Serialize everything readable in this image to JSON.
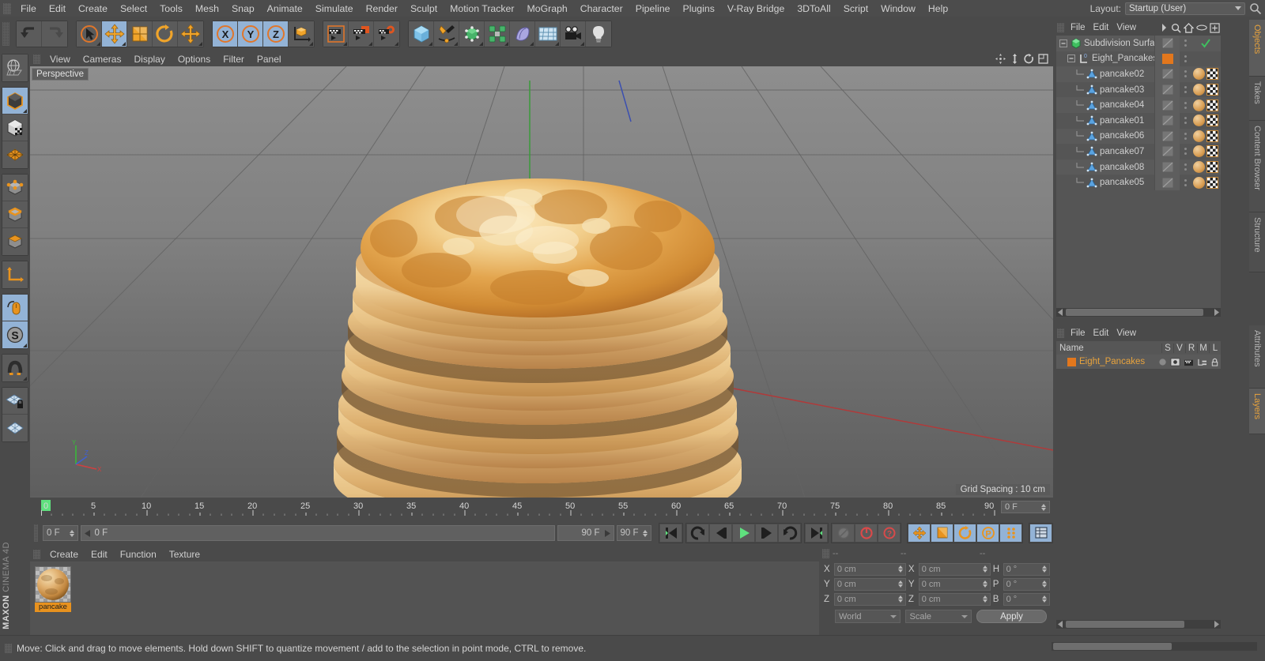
{
  "menubar": {
    "items": [
      "File",
      "Edit",
      "Create",
      "Select",
      "Tools",
      "Mesh",
      "Snap",
      "Animate",
      "Simulate",
      "Render",
      "Sculpt",
      "Motion Tracker",
      "MoGraph",
      "Character",
      "Pipeline",
      "Plugins",
      "V-Ray Bridge",
      "3DToAll",
      "Script",
      "Window",
      "Help"
    ],
    "layout_label": "Layout:",
    "layout_value": "Startup (User)"
  },
  "toolbar": {
    "groups": [
      {
        "name": "history",
        "buttons": [
          {
            "icon": "undo-icon",
            "state": "normal"
          },
          {
            "icon": "redo-icon",
            "state": "disabled"
          }
        ]
      },
      {
        "name": "transform",
        "buttons": [
          {
            "icon": "select-live-icon",
            "state": "normal"
          },
          {
            "icon": "move-tool-icon",
            "state": "active"
          },
          {
            "icon": "scale-tool-icon",
            "state": "normal"
          },
          {
            "icon": "rotate-tool-icon",
            "state": "normal"
          },
          {
            "icon": "move-axis-icon",
            "state": "normal"
          }
        ]
      },
      {
        "name": "axis-locks",
        "buttons": [
          {
            "icon": "axis-x-icon",
            "state": "active"
          },
          {
            "icon": "axis-y-icon",
            "state": "active"
          },
          {
            "icon": "axis-z-icon",
            "state": "active"
          },
          {
            "icon": "world-coordinates-icon",
            "state": "normal"
          }
        ]
      },
      {
        "name": "render",
        "buttons": [
          {
            "icon": "render-view-icon",
            "state": "normal"
          },
          {
            "icon": "render-to-picture-viewer-icon",
            "state": "normal"
          },
          {
            "icon": "render-settings-icon",
            "state": "normal"
          }
        ]
      },
      {
        "name": "create",
        "buttons": [
          {
            "icon": "primitive-cube-icon",
            "state": "normal"
          },
          {
            "icon": "spline-pen-icon",
            "state": "normal"
          },
          {
            "icon": "generator-nurbs-icon",
            "state": "normal"
          },
          {
            "icon": "deformer-icon",
            "state": "normal"
          },
          {
            "icon": "scene-object-icon",
            "state": "normal"
          },
          {
            "icon": "environment-floor-icon",
            "state": "normal"
          },
          {
            "icon": "camera-icon",
            "state": "normal"
          },
          {
            "icon": "light-icon",
            "state": "normal"
          }
        ]
      }
    ]
  },
  "left_toolbar": {
    "items": [
      {
        "icon": "globe-uv-icon",
        "state": "normal"
      },
      {
        "icon": "model-mode-icon",
        "state": "active"
      },
      {
        "icon": "texture-mode-icon",
        "state": "normal"
      },
      {
        "icon": "workplane-icon",
        "state": "normal"
      },
      {
        "icon": "points-mode-icon",
        "state": "normal"
      },
      {
        "icon": "edges-mode-icon",
        "state": "normal"
      },
      {
        "icon": "polygons-mode-icon",
        "state": "normal"
      },
      {
        "icon": "axis-modify-icon",
        "state": "normal"
      },
      {
        "icon": "enable-snapping-icon",
        "state": "active"
      },
      {
        "icon": "soft-selection-icon",
        "state": "active"
      },
      {
        "icon": "magnet-icon",
        "state": "normal"
      },
      {
        "icon": "workplane-lock-icon",
        "state": "normal"
      },
      {
        "icon": "workplane-mode-icon",
        "state": "normal"
      }
    ],
    "brand_line1": "MAXON",
    "brand_line2": "CINEMA 4D"
  },
  "viewport": {
    "menus": [
      "View",
      "Cameras",
      "Display",
      "Options",
      "Filter",
      "Panel"
    ],
    "nav_icons": [
      "pan-view-icon",
      "zoom-view-icon",
      "rotate-view-icon",
      "maximize-view-icon"
    ],
    "perspective_label": "Perspective",
    "grid_spacing": "Grid Spacing : 10 cm",
    "axis_labels": {
      "x": "X",
      "y": "Y",
      "z": "Z"
    }
  },
  "timeline": {
    "ticks": [
      "0",
      "5",
      "10",
      "15",
      "20",
      "25",
      "30",
      "35",
      "40",
      "45",
      "50",
      "55",
      "60",
      "65",
      "70",
      "75",
      "80",
      "85",
      "90"
    ],
    "end_field": "0 F",
    "current_frame": 0,
    "min_frame": 0,
    "max_frame": 90
  },
  "transport": {
    "current_frame_field": "0 F",
    "preview_range_field": "0 F",
    "preview_end_field": "90 F",
    "document_end_field": "90 F",
    "buttons": [
      {
        "icon": "go-to-start-icon",
        "state": "normal"
      },
      {
        "icon": "play-backwards-loop-icon",
        "state": "normal"
      },
      {
        "icon": "previous-frame-icon",
        "state": "normal"
      },
      {
        "icon": "play-forward-icon",
        "state": "active"
      },
      {
        "icon": "next-frame-icon",
        "state": "normal"
      },
      {
        "icon": "play-forward-loop-icon",
        "state": "normal"
      },
      {
        "icon": "go-to-end-icon",
        "state": "normal"
      },
      {
        "icon": "record-active-objects-icon",
        "state": "disabled"
      },
      {
        "icon": "autokeying-icon",
        "state": "normal"
      },
      {
        "icon": "keyframe-selection-icon",
        "state": "normal"
      },
      {
        "icon": "position-key-icon",
        "state": "active"
      },
      {
        "icon": "scale-key-icon",
        "state": "active"
      },
      {
        "icon": "rotation-key-icon",
        "state": "active"
      },
      {
        "icon": "parameter-key-icon",
        "state": "active"
      },
      {
        "icon": "point-level-animation-icon",
        "state": "active"
      },
      {
        "icon": "timeline-view-icon",
        "state": "active"
      }
    ]
  },
  "material_manager": {
    "menus": [
      "Create",
      "Edit",
      "Function",
      "Texture"
    ],
    "materials": [
      {
        "name": "pancake",
        "selected": true
      }
    ]
  },
  "coordinates": {
    "header_dashes": [
      "--",
      "--",
      "--"
    ],
    "rows": [
      {
        "label": "X",
        "position": "0 cm",
        "label2": "X",
        "size": "0 cm",
        "label3": "H",
        "rotation": "0 °"
      },
      {
        "label": "Y",
        "position": "0 cm",
        "label2": "Y",
        "size": "0 cm",
        "label3": "P",
        "rotation": "0 °"
      },
      {
        "label": "Z",
        "position": "0 cm",
        "label2": "Z",
        "size": "0 cm",
        "label3": "B",
        "rotation": "0 °"
      }
    ],
    "system_select": "World",
    "mode_select": "Scale",
    "apply_label": "Apply"
  },
  "object_manager": {
    "menus": [
      "File",
      "Edit",
      "View"
    ],
    "header_icons": [
      "more-icon",
      "search-icon",
      "home-icon",
      "ellipse-icon",
      "add-layer-icon"
    ],
    "tree": [
      {
        "name": "Subdivision Surface",
        "depth": 0,
        "icon": "subdivision-surface-icon",
        "checked": true,
        "has_material": false
      },
      {
        "name": "Eight_Pancakes",
        "depth": 1,
        "icon": "null-object-icon",
        "layer_color": "#e2771d",
        "has_material": false
      },
      {
        "name": "pancake02",
        "depth": 2,
        "icon": "polygon-object-icon",
        "has_material": true
      },
      {
        "name": "pancake03",
        "depth": 2,
        "icon": "polygon-object-icon",
        "has_material": true
      },
      {
        "name": "pancake04",
        "depth": 2,
        "icon": "polygon-object-icon",
        "has_material": true
      },
      {
        "name": "pancake01",
        "depth": 2,
        "icon": "polygon-object-icon",
        "has_material": true
      },
      {
        "name": "pancake06",
        "depth": 2,
        "icon": "polygon-object-icon",
        "has_material": true
      },
      {
        "name": "pancake07",
        "depth": 2,
        "icon": "polygon-object-icon",
        "has_material": true
      },
      {
        "name": "pancake08",
        "depth": 2,
        "icon": "polygon-object-icon",
        "has_material": true
      },
      {
        "name": "pancake05",
        "depth": 2,
        "icon": "polygon-object-icon",
        "has_material": true
      }
    ]
  },
  "layers_panel": {
    "menus": [
      "File",
      "Edit",
      "View"
    ],
    "columns": [
      "Name",
      "S",
      "V",
      "R",
      "M",
      "L"
    ],
    "rows": [
      {
        "name": "Eight_Pancakes",
        "color": "#e2771d"
      }
    ]
  },
  "right_tabs_top": [
    {
      "label": "Objects",
      "active": true
    },
    {
      "label": "Takes",
      "active": false
    },
    {
      "label": "Content Browser",
      "active": false
    },
    {
      "label": "Structure",
      "active": false
    }
  ],
  "right_tabs_bottom": [
    {
      "label": "Attributes",
      "active": false
    },
    {
      "label": "Layers",
      "active": true
    }
  ],
  "statusbar": {
    "message": "Move: Click and drag to move elements. Hold down SHIFT to quantize movement / add to the selection in point mode, CTRL to remove."
  },
  "colors": {
    "accent_orange": "#e8a33d",
    "active_blue": "#93b3d6",
    "panel_bg": "#4a4a4a",
    "field_bg": "#555555",
    "layer_swatch": "#e2771d"
  }
}
